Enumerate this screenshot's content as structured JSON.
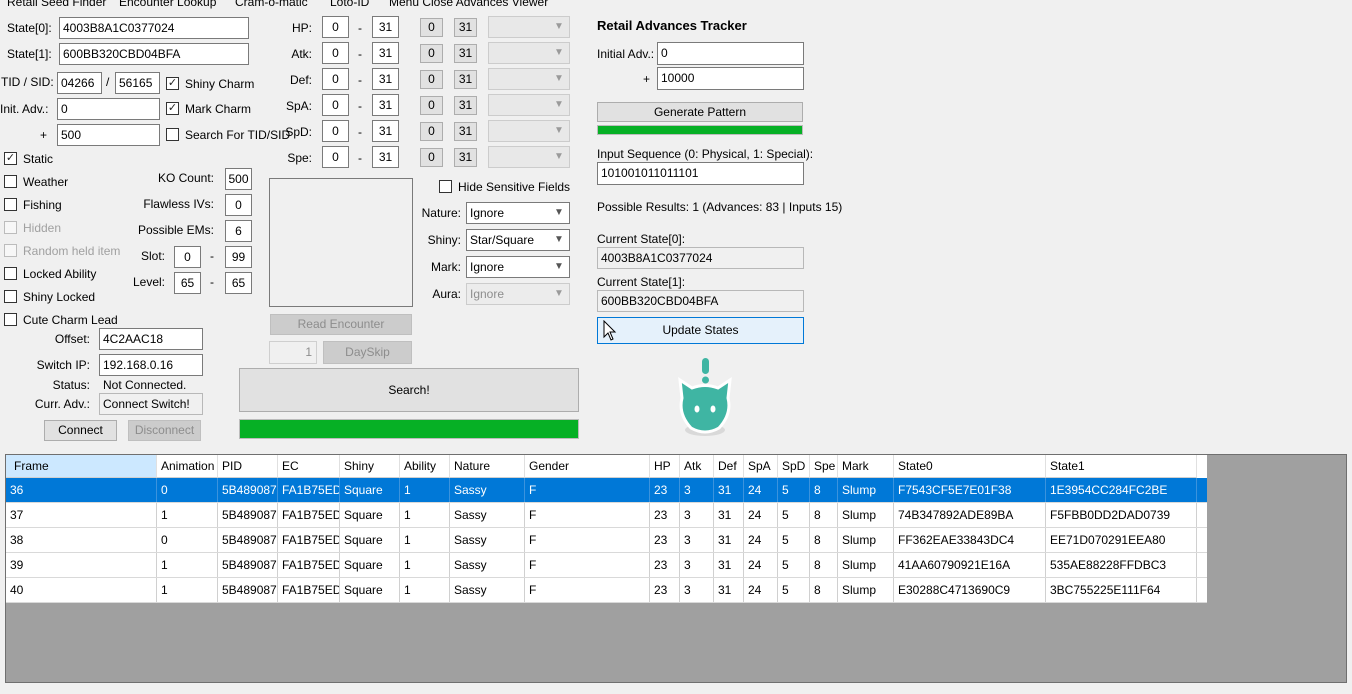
{
  "menu": [
    "Retail Seed Finder",
    "Encounter Lookup",
    "Cram-o-matic",
    "Loto-ID",
    "Menu Close Advances Viewer"
  ],
  "rng": {
    "state0_label": "State[0]:",
    "state0": "4003B8A1C0377024",
    "state1_label": "State[1]:",
    "state1": "600BB320CBD04BFA",
    "tidsid_label": "TID / SID:",
    "tid": "04266",
    "slash": "/",
    "sid": "56165",
    "init_adv_label": "Init. Adv.:",
    "init_adv": "0",
    "plus": "+",
    "max_adv": "500"
  },
  "charms": {
    "shiny_charm": "Shiny Charm",
    "shiny_charm_checked": true,
    "mark_charm": "Mark Charm",
    "mark_charm_checked": true,
    "search_tidsid": "Search For TID/SID",
    "search_tidsid_checked": false
  },
  "ivs": {
    "dash": "-",
    "rows": [
      {
        "label": "HP:",
        "min": "0",
        "max": "31",
        "b0": "0",
        "b1": "31"
      },
      {
        "label": "Atk:",
        "min": "0",
        "max": "31",
        "b0": "0",
        "b1": "31"
      },
      {
        "label": "Def:",
        "min": "0",
        "max": "31",
        "b0": "0",
        "b1": "31"
      },
      {
        "label": "SpA:",
        "min": "0",
        "max": "31",
        "b0": "0",
        "b1": "31"
      },
      {
        "label": "SpD:",
        "min": "0",
        "max": "31",
        "b0": "0",
        "b1": "31"
      },
      {
        "label": "Spe:",
        "min": "0",
        "max": "31",
        "b0": "0",
        "b1": "31"
      }
    ]
  },
  "encounter": {
    "static": "Static",
    "weather": "Weather",
    "fishing": "Fishing",
    "hidden": "Hidden",
    "random_held_item": "Random held item",
    "locked_ability": "Locked Ability",
    "shiny_locked": "Shiny Locked",
    "cute_charm_lead": "Cute Charm Lead",
    "ko_count_label": "KO Count:",
    "ko_count": "500",
    "flawless_label": "Flawless IVs:",
    "flawless": "0",
    "possible_ems_label": "Possible EMs:",
    "possible_ems": "6",
    "slot_label": "Slot:",
    "slot_min": "0",
    "slot_max": "99",
    "level_label": "Level:",
    "level_min": "65",
    "level_max": "65",
    "dash": "-"
  },
  "filters": {
    "hide_sensitive": "Hide Sensitive Fields",
    "nature_label": "Nature:",
    "nature": "Ignore",
    "shiny_label": "Shiny:",
    "shiny": "Star/Square",
    "mark_label": "Mark:",
    "mark": "Ignore",
    "aura_label": "Aura:",
    "aura": "Ignore"
  },
  "connection": {
    "offset_label": "Offset:",
    "offset": "4C2AAC18",
    "switch_ip_label": "Switch IP:",
    "switch_ip": "192.168.0.16",
    "status_label": "Status:",
    "status": "Not Connected.",
    "curr_adv_label": "Curr. Adv.:",
    "curr_adv": "Connect Switch!",
    "connect": "Connect",
    "disconnect": "Disconnect"
  },
  "actions": {
    "read_encounter": "Read Encounter",
    "dayskip_count": "1",
    "dayskip": "DaySkip",
    "search": "Search!",
    "search_progress": 1.0
  },
  "tracker": {
    "title": "Retail Advances Tracker",
    "initial_adv_label": "Initial Adv.:",
    "initial_adv": "0",
    "plus": "+",
    "range": "10000",
    "generate": "Generate Pattern",
    "pattern_progress": 1.0,
    "input_seq_label": "Input Sequence (0: Physical, 1: Special):",
    "input_seq": "101001011011101",
    "possible_results": "Possible Results: 1 (Advances: 83 | Inputs 15)",
    "cur_state0_label": "Current State[0]:",
    "cur_state0": "4003B8A1C0377024",
    "cur_state1_label": "Current State[1]:",
    "cur_state1": "600BB320CBD04BFA",
    "update": "Update States"
  },
  "grid": {
    "columns": [
      "Frame",
      "Animation",
      "PID",
      "EC",
      "Shiny",
      "Ability",
      "Nature",
      "Gender",
      "HP",
      "Atk",
      "Def",
      "SpA",
      "SpD",
      "Spe",
      "Mark",
      "State0",
      "State1"
    ],
    "rows": [
      [
        "36",
        "0",
        "5B489087",
        "FA1B75ED",
        "Square",
        "1",
        "Sassy",
        "F",
        "23",
        "3",
        "31",
        "24",
        "5",
        "8",
        "Slump",
        "F7543CF5E7E01F38",
        "1E3954CC284FC2BE"
      ],
      [
        "37",
        "1",
        "5B489087",
        "FA1B75ED",
        "Square",
        "1",
        "Sassy",
        "F",
        "23",
        "3",
        "31",
        "24",
        "5",
        "8",
        "Slump",
        "74B347892ADE89BA",
        "F5FBB0DD2DAD0739"
      ],
      [
        "38",
        "0",
        "5B489087",
        "FA1B75ED",
        "Square",
        "1",
        "Sassy",
        "F",
        "23",
        "3",
        "31",
        "24",
        "5",
        "8",
        "Slump",
        "FF362EAE33843DC4",
        "EE71D070291EEA80"
      ],
      [
        "39",
        "1",
        "5B489087",
        "FA1B75ED",
        "Square",
        "1",
        "Sassy",
        "F",
        "23",
        "3",
        "31",
        "24",
        "5",
        "8",
        "Slump",
        "41AA60790921E16A",
        "535AE88228FFDBC3"
      ],
      [
        "40",
        "1",
        "5B489087",
        "FA1B75ED",
        "Square",
        "1",
        "Sassy",
        "F",
        "23",
        "3",
        "31",
        "24",
        "5",
        "8",
        "Slump",
        "E30288C4713690C9",
        "3BC755225E111F64"
      ]
    ],
    "selected_row": 0
  },
  "colors": {
    "accent": "#0078d7",
    "progress": "#06b025",
    "mascot": "#3fb5a3"
  }
}
